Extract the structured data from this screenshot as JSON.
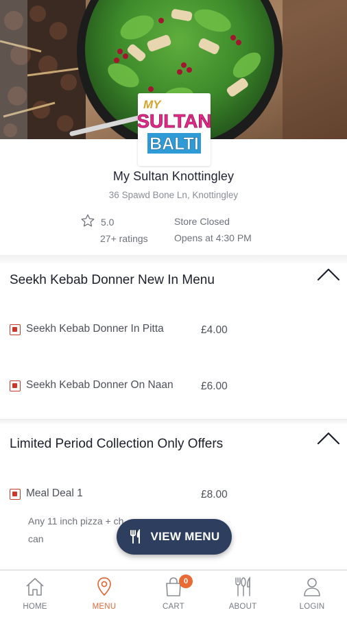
{
  "store": {
    "name": "My Sultan Knottingley",
    "address": "36 Spawd Bone Ln, Knottingley",
    "rating": "5.0",
    "rating_count": "27+ ratings",
    "status": "Store Closed",
    "opens": "Opens at 4:30 PM",
    "logo_text": {
      "my": "MY",
      "sultan": "SULTAN",
      "balti": "BALTI"
    }
  },
  "sections": [
    {
      "title": "Seekh Kebab Donner New In Menu",
      "items": [
        {
          "name": "Seekh Kebab Donner In Pitta",
          "price": "£4.00"
        },
        {
          "name": "Seekh Kebab Donner On Naan",
          "price": "£6.00"
        }
      ]
    },
    {
      "title": "Limited Period Collection Only Offers",
      "items": [
        {
          "name": "Meal Deal 1",
          "price": "£8.00",
          "description_line1": "Any 11 inch pizza + ch",
          "description_line2": "can"
        }
      ]
    }
  ],
  "view_menu": {
    "label": "VIEW MENU"
  },
  "nav": {
    "items": [
      {
        "label": "HOME",
        "icon": "home-icon"
      },
      {
        "label": "MENU",
        "icon": "location-pin-icon",
        "active": true
      },
      {
        "label": "CART",
        "icon": "bag-icon",
        "badge": "0"
      },
      {
        "label": "ABOUT",
        "icon": "cutlery-icon"
      },
      {
        "label": "LOGIN",
        "icon": "user-icon"
      }
    ]
  },
  "colors": {
    "accent": "#E06A3B",
    "navy": "#2D3E5F",
    "veg_mark": "#C9392B",
    "badge": "#EA6A35"
  }
}
